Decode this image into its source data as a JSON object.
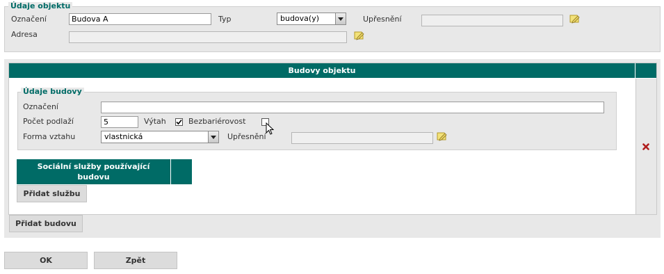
{
  "udaje_objektu": {
    "legend": "Údaje objektu",
    "oznaceni_label": "Označení",
    "oznaceni_value": "Budova A",
    "typ_label": "Typ",
    "typ_selected": "budova(y)",
    "upresneni_label": "Upřesnění",
    "upresneni_value": "",
    "adresa_label": "Adresa",
    "adresa_value": ""
  },
  "budovy": {
    "header": "Budovy objektu",
    "udaje_budovy": {
      "legend": "Údaje budovy",
      "oznaceni_label": "Označení",
      "oznaceni_value": "",
      "pocet_podlazi_label": "Počet podlaží",
      "pocet_podlazi_value": "5",
      "vytah_label": "Výtah",
      "vytah_checked": true,
      "bezbarierovost_label": "Bezbariérovost",
      "bezbarierovost_checked": false,
      "forma_vztahu_label": "Forma vztahu",
      "forma_vztahu_selected": "vlastnická",
      "upresneni_label": "Upřesnění",
      "upresneni_value": ""
    },
    "socialni_sluzby_header": "Sociální služby používající budovu",
    "pridat_sluzbu": "Přidat službu",
    "delete_icon": "delete-x-icon"
  },
  "buttons": {
    "pridat_budovu": "Přidat budovu",
    "ok": "OK",
    "zpet": "Zpět"
  },
  "colors": {
    "accent": "#006b66",
    "panel": "#e8e8e8",
    "delete": "#b01e1e"
  }
}
